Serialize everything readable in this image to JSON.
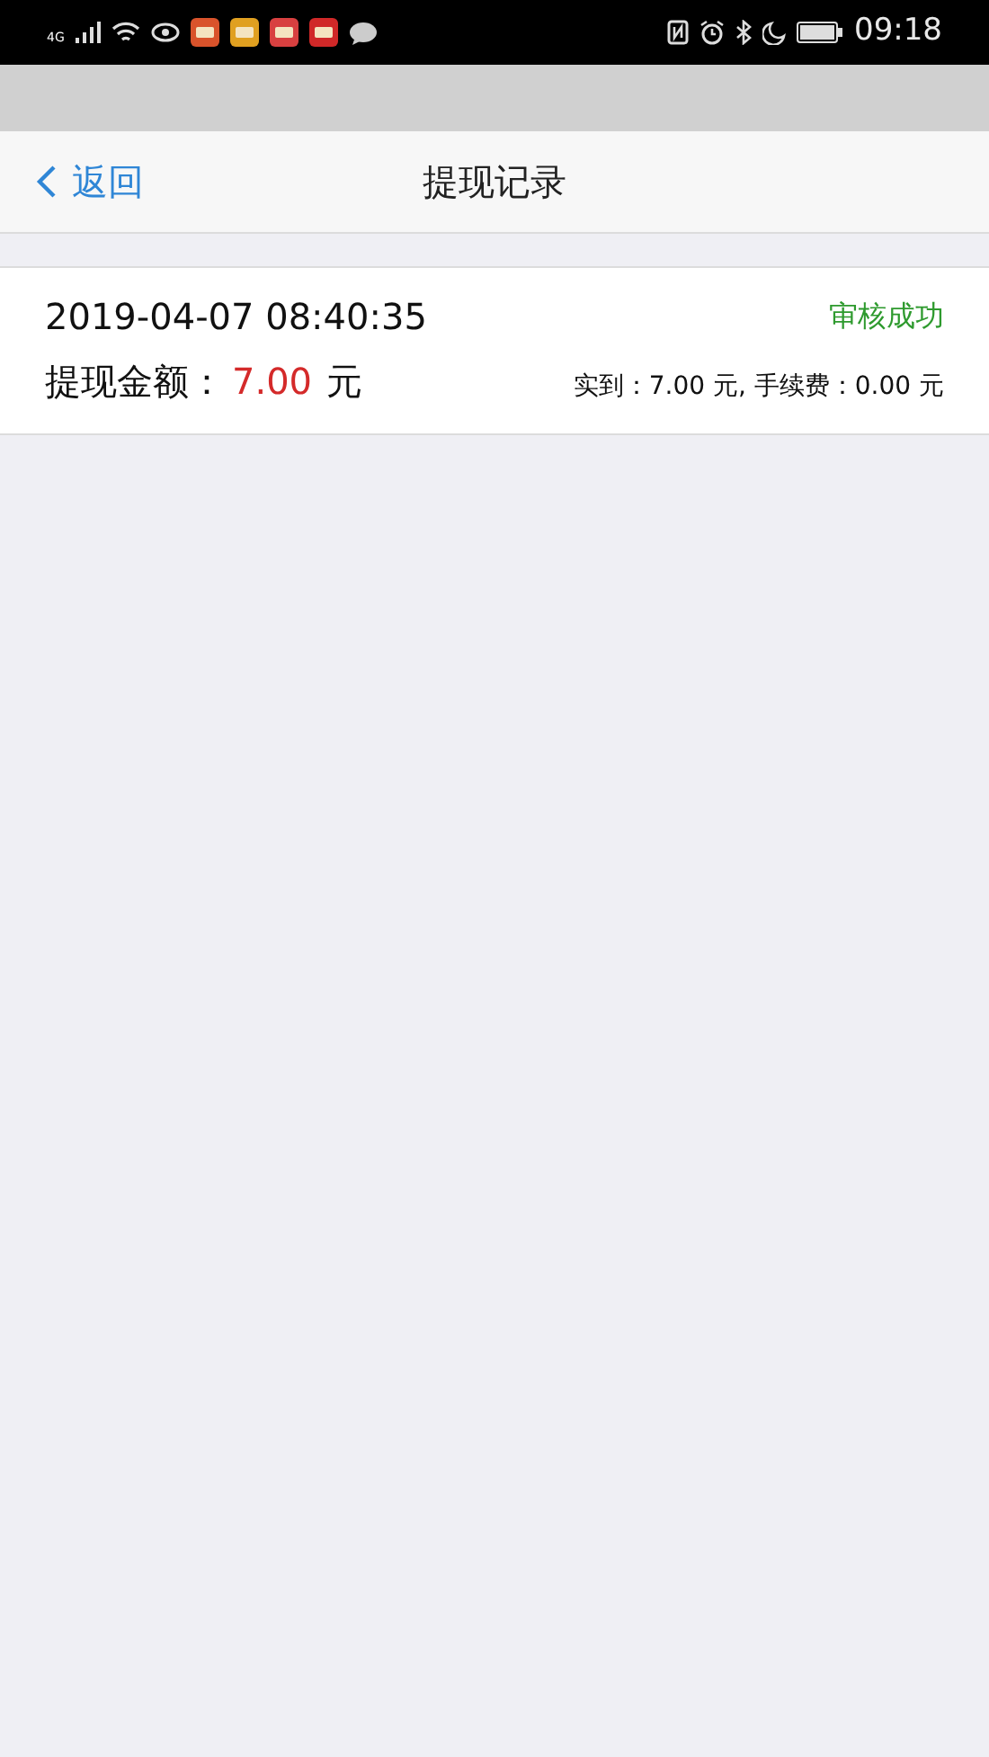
{
  "status_bar": {
    "network": "4G",
    "time": "09:18"
  },
  "nav": {
    "back": "返回",
    "title": "提现记录"
  },
  "records": [
    {
      "datetime": "2019-04-07 08:40:35",
      "status": "审核成功",
      "color": "#2e9a2e",
      "amount_label": "提现金额：",
      "amount": "7.00",
      "amount_unit": "元",
      "detail": "实到：7.00 元, 手续费：0.00 元"
    }
  ]
}
